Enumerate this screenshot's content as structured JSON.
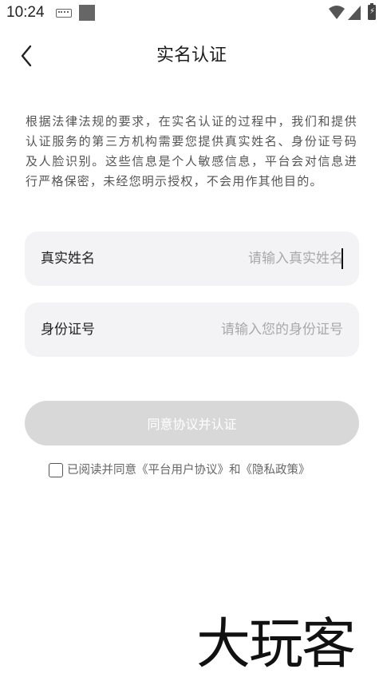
{
  "status_bar": {
    "time": "10:24",
    "icons": [
      "keyboard-icon",
      "app-square-icon",
      "wifi-icon",
      "signal-icon",
      "battery-charging-icon"
    ]
  },
  "header": {
    "title": "实名认证",
    "back_icon": "chevron-left-icon"
  },
  "notice_text": "根据法律法规的要求，在实名认证的过程中，我们和提供认证服务的第三方机构需要您提供真实姓名、身份证号码及人脸识别。这些信息是个人敏感信息，平台会对信息进行严格保密，未经您明示授权，不会用作其他目的。",
  "form": {
    "name": {
      "label": "真实姓名",
      "value": "",
      "placeholder": "请输入真实姓名"
    },
    "id_number": {
      "label": "身份证号",
      "value": "",
      "placeholder": "请输入您的身份证号"
    }
  },
  "submit_label": "同意协议并认证",
  "agreement": {
    "checked": false,
    "prefix": "已阅读并同意",
    "user_agreement_link": "《平台用户协议》",
    "joiner": "和",
    "privacy_link": "《隐私政策》"
  },
  "watermark": {
    "text": "大玩客"
  },
  "colors": {
    "field_background": "#f3f3f6",
    "button_disabled": "#d8d8d8",
    "placeholder": "#a8a8ad",
    "notice_text": "#555555"
  }
}
